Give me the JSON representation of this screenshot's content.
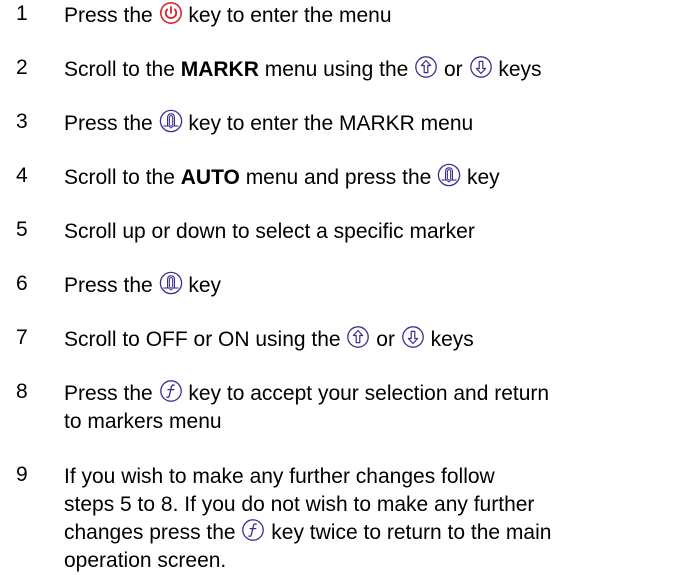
{
  "steps": [
    {
      "num": "1",
      "parts": [
        "Press the ",
        {
          "icon": "power-icon"
        },
        " key to enter the menu"
      ]
    },
    {
      "num": "2",
      "parts": [
        "Scroll to the ",
        {
          "b": "MARKR"
        },
        " menu using the ",
        {
          "icon": "up-arrow-icon"
        },
        " or ",
        {
          "icon": "down-arrow-icon"
        },
        " keys"
      ]
    },
    {
      "num": "3",
      "parts": [
        "Press the ",
        {
          "icon": "enter-key-icon"
        },
        " key to enter the MARKR menu"
      ]
    },
    {
      "num": "4",
      "parts": [
        "Scroll to the ",
        {
          "b": "AUTO"
        },
        " menu and press the ",
        {
          "icon": "enter-key-icon"
        },
        " key"
      ]
    },
    {
      "num": "5",
      "parts": [
        "Scroll up or down to select a specific marker"
      ]
    },
    {
      "num": "6",
      "parts": [
        "Press the ",
        {
          "icon": "enter-key-icon"
        },
        " key"
      ]
    },
    {
      "num": "7",
      "parts": [
        "Scroll to OFF or ON using the ",
        {
          "icon": "up-arrow-icon"
        },
        " or ",
        {
          "icon": "down-arrow-icon"
        },
        " keys"
      ]
    },
    {
      "num": "8",
      "parts": [
        "Press the ",
        {
          "icon": "function-key-icon"
        },
        " key to accept your selection and return",
        {
          "br": true
        },
        "to markers menu"
      ]
    },
    {
      "num": "9",
      "parts": [
        "If you wish to make any further changes follow",
        {
          "br": true
        },
        "steps 5 to 8. If you do not wish to make any further",
        {
          "br": true
        },
        "changes press the ",
        {
          "icon": "function-key-icon"
        },
        " key twice to return to the main",
        {
          "br": true
        },
        "operation screen."
      ]
    }
  ],
  "colors": {
    "icon_accent": "#d9252a",
    "icon_stroke": "#3a2f8f"
  }
}
